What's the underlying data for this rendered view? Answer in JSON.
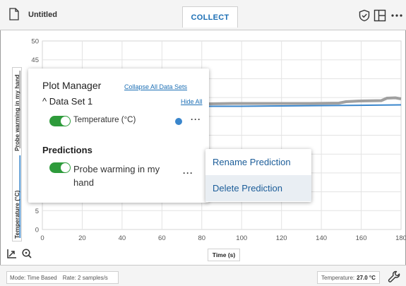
{
  "header": {
    "title": "Untitled",
    "collect_label": "COLLECT"
  },
  "graph": {
    "y_axis_labels": [
      "Probe warming in my hand",
      "Temperature (°C)"
    ],
    "y_ticks": [
      "50",
      "45",
      "5",
      "0"
    ],
    "x_ticks": [
      "0",
      "20",
      "40",
      "60",
      "80",
      "100",
      "120",
      "140",
      "160",
      "180"
    ],
    "x_title": "Time (s)",
    "series_colors": {
      "temperature": "#3a86cc",
      "prediction": "#a0a0a0"
    }
  },
  "plot_manager": {
    "title": "Plot Manager",
    "collapse_link": "Collapse All Data Sets",
    "dataset_label": "Data Set 1",
    "hide_all_link": "Hide All",
    "temperature_label": "Temperature (°C)",
    "predictions_heading": "Predictions",
    "prediction_label": "Probe warming in my hand",
    "more_label": "···"
  },
  "context_menu": {
    "items": [
      "Rename Prediction",
      "Delete Prediction"
    ]
  },
  "footer": {
    "mode": "Mode: Time Based",
    "rate": "Rate: 2 samples/s",
    "temperature_prefix": "Temperature:",
    "temperature_value": "27.0 °C"
  },
  "icons": {
    "document": "document-icon",
    "shield": "shield-check-icon",
    "layout": "layout-grid-icon",
    "more": "more-horizontal-icon",
    "autoscale": "autoscale-icon",
    "zoom": "zoom-icon",
    "wrench": "wrench-icon"
  }
}
